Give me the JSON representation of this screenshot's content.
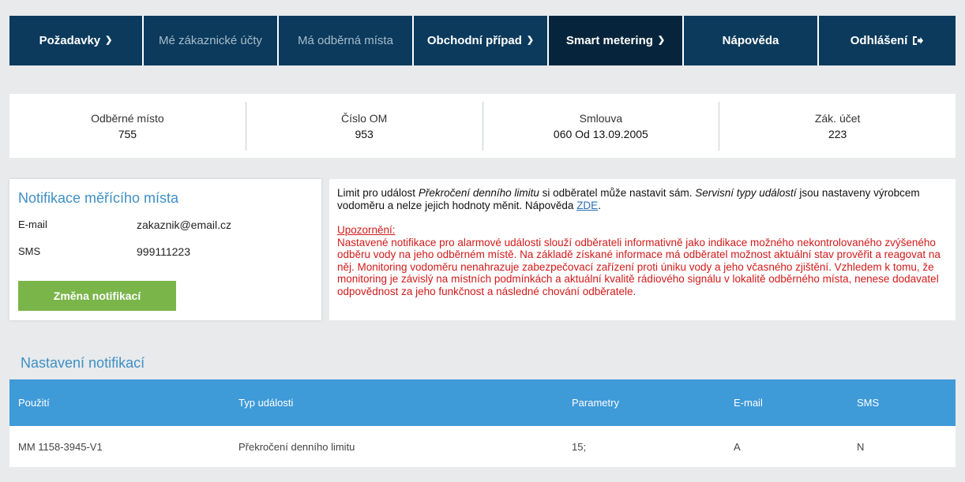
{
  "nav": {
    "items": [
      {
        "label": "Požadavky",
        "chevron": true
      },
      {
        "label": "Mé zákaznické účty",
        "chevron": false
      },
      {
        "label": "Má odběrná místa",
        "chevron": false
      },
      {
        "label": "Obchodní případ",
        "chevron": true
      },
      {
        "label": "Smart metering",
        "chevron": true
      },
      {
        "label": "Nápověda",
        "chevron": false
      },
      {
        "label": "Odhlášení",
        "chevron": false
      }
    ]
  },
  "info": {
    "odberne_misto": {
      "label": "Odběrné místo",
      "value": "755"
    },
    "cislo_om": {
      "label": "Číslo OM",
      "value": "953"
    },
    "smlouva": {
      "label": "Smlouva",
      "value": "060 Od 13.09.2005"
    },
    "zak_ucet": {
      "label": "Zák. účet",
      "value": "223"
    }
  },
  "notif_card": {
    "title": "Notifikace měřícího místa",
    "email_label": "E-mail",
    "email_value": "zakaznik@email.cz",
    "sms_label": "SMS",
    "sms_value": "999111223",
    "button_label": "Změna notifikací"
  },
  "notice": {
    "p1_a": "Limit pro událost ",
    "p1_em1": "Překročení denního limitu",
    "p1_b": " si odběratel může nastavit sám. ",
    "p1_em2": "Servisní typy událostí",
    "p1_c": " jsou nastaveny výrobcem vodoměru a nelze jejich hodnoty měnit. Nápověda ",
    "link": "ZDE",
    "p1_d": ".",
    "warn_title": "Upozornění:",
    "warn_text": "Nastavené notifikace pro alarmové události slouží odběrateli informativně jako indikace možného nekontrolovaného zvýšeného odběru vody na jeho odběrném místě. Na základě získané informace má odběratel možnost aktuální stav prověřit a reagovat na něj. Monitoring vodoměru nenahrazuje zabezpečovací zařízení proti úniku vody a jeho včasného zjištění. Vzhledem k tomu, že monitoring je závislý na místních podmínkách a aktuální kvalitě rádiového signálu v lokalitě odběrného místa, nenese dodavatel odpovědnost za jeho funkčnost a následné chování odběratele."
  },
  "settings": {
    "title": "Nastavení notifikací",
    "columns": [
      "Použití",
      "Typ události",
      "Parametry",
      "E-mail",
      "SMS"
    ],
    "rows": [
      [
        "MM 1158-3945-V1",
        "Překročení denního limitu",
        "15;",
        "A",
        "N"
      ]
    ]
  },
  "colors": {
    "nav_bg": "#0b3a5c",
    "accent_blue": "#3f9ad8",
    "green_button": "#7ab54a",
    "warning_red": "#d11a1a"
  }
}
